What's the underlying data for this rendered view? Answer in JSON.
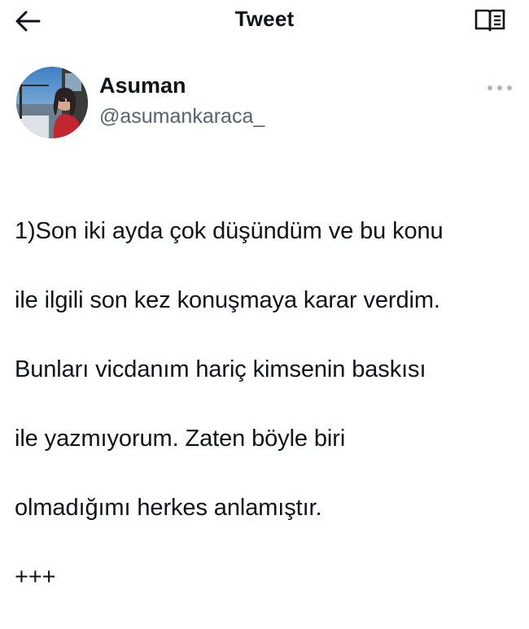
{
  "topbar": {
    "back_icon": "arrow-left-icon",
    "title": "Tweet",
    "reader_icon": "open-book-icon"
  },
  "author": {
    "display_name": "Asuman",
    "handle": "@asumankaraca_",
    "more_icon": "more-horizontal-icon"
  },
  "tweet": {
    "lines": [
      "1)Son iki ayda çok düşündüm ve bu konu",
      "ile ilgili son kez konuşmaya karar verdim.",
      "Bunları vicdanım hariç kimsenin baskısı",
      "ile yazmıyorum. Zaten böyle biri",
      "olmadığımı herkes anlamıştır.",
      "+++"
    ]
  },
  "colors": {
    "text": "#0f1419",
    "secondary": "#536471",
    "more_dots": "#aab8c2"
  }
}
